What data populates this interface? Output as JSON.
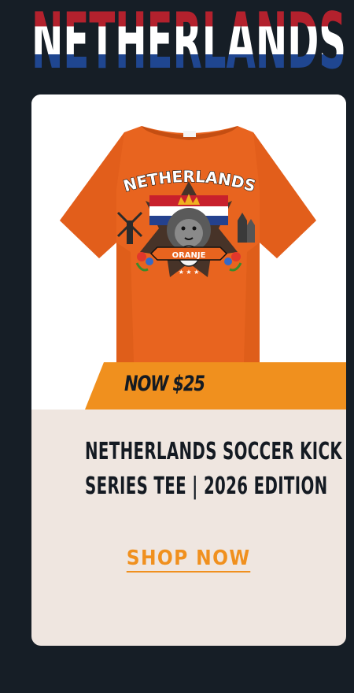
{
  "header": {
    "title": "NETHERLANDS"
  },
  "product": {
    "image": {
      "shirt_color": "#e8641f",
      "graphic_title": "NETHERLANDS",
      "graphic_ribbon": "ORANJE"
    },
    "price_badge": "NOW $25",
    "title_line_1": "NETHERLANDS SOCCER KICK OFF",
    "title_line_2": "SERIES TEE | 2026 EDITION",
    "cta_label": "SHOP NOW"
  },
  "colors": {
    "page_background": "#161e26",
    "card_background": "#efe6e0",
    "accent_orange": "#f0901e",
    "flag_red": "#b3212d",
    "flag_white": "#ffffff",
    "flag_blue": "#1f4690",
    "text_dark": "#141a22"
  }
}
